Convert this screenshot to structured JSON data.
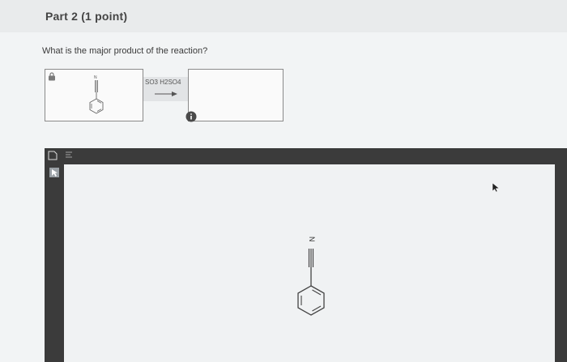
{
  "part": {
    "title": "Part 2  (1 point)"
  },
  "question": {
    "text": "What is the major product of the reaction?"
  },
  "reaction": {
    "reagent": "SO3 H2SO4",
    "reactant_atom_label": "N",
    "product": ""
  },
  "editor": {
    "canvas_atom_label": "N"
  },
  "icons": {
    "lock": "lock-icon",
    "info": "info-icon",
    "new_sheet": "square-icon",
    "templates": "ring-template-icon",
    "select": "select-arrow-icon",
    "cursor": "mouse-cursor-icon"
  },
  "colors": {
    "header_bg": "#e9ebec",
    "editor_frame": "#3b3b3b",
    "canvas_bg": "#f0f2f3",
    "info_icon": "#4a4a4a"
  }
}
